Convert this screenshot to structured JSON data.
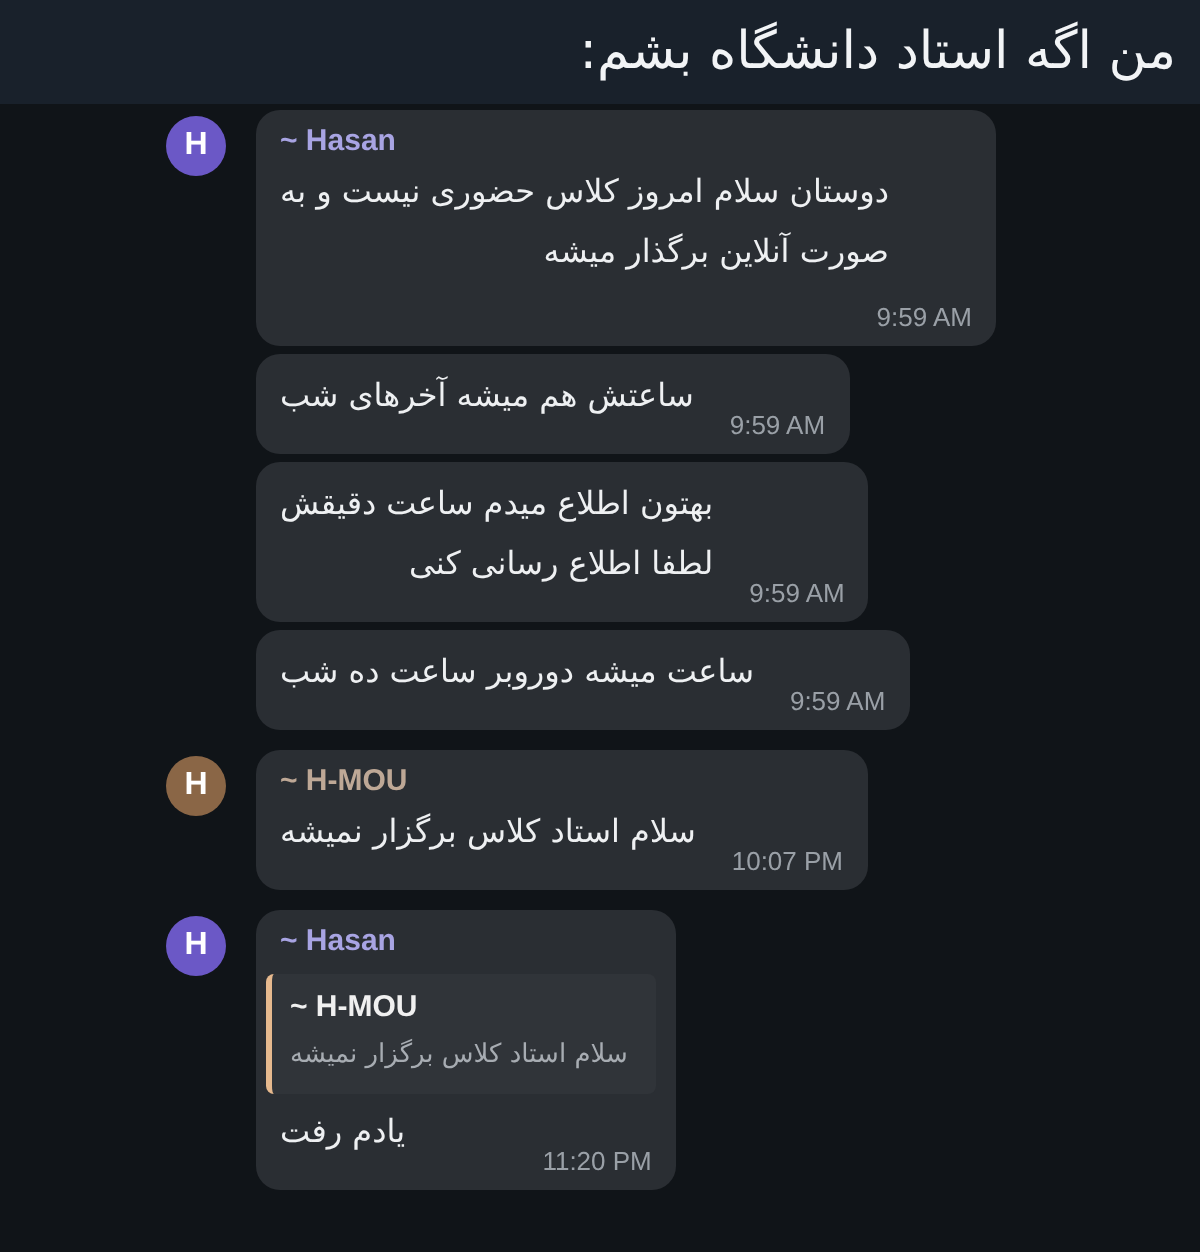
{
  "title": "من اگه استاد دانشگاه بشم:",
  "groups": [
    {
      "sender": "~ Hasan",
      "avatar": "H",
      "color": "#6b58c6",
      "messages": [
        {
          "text": "دوستان سلام امروز کلاس حضوری نیست و به\nصورت آنلاین برگذار میشه",
          "time": "9:59 AM"
        },
        {
          "text": "ساعتش هم میشه آخرهای شب",
          "time": "9:59 AM"
        },
        {
          "text": "بهتون اطلاع میدم ساعت دقیقش\nلطفا اطلاع رسانی کنی",
          "time": "9:59 AM"
        },
        {
          "text": "ساعت میشه دوروبر ساعت ده شب",
          "time": "9:59 AM"
        }
      ]
    },
    {
      "sender": "~ H-MOU",
      "avatar": "H",
      "color": "#8a6646",
      "messages": [
        {
          "text": "سلام استاد کلاس برگزار نمیشه",
          "time": "10:07 PM"
        }
      ]
    },
    {
      "sender": "~ Hasan",
      "avatar": "H",
      "color": "#6b58c6",
      "messages": [
        {
          "reply": {
            "sender": "~ H-MOU",
            "text": "سلام استاد کلاس برگزار نمیشه"
          },
          "text": "یادم رفت",
          "time": "11:20 PM"
        }
      ]
    }
  ]
}
